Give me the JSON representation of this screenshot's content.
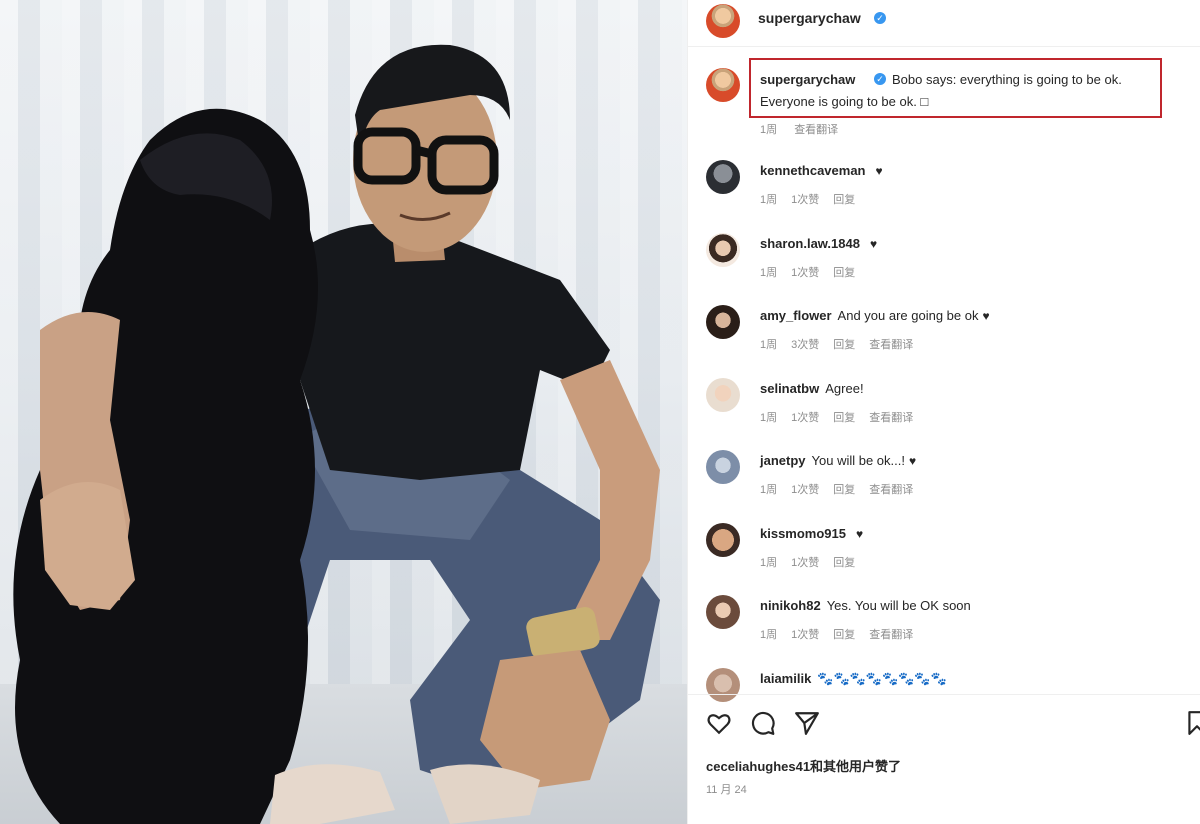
{
  "post": {
    "username": "supergarychaw",
    "caption": {
      "line1": "Bobo says: everything is going to be ok.",
      "line2": "Everyone is going to be ok. □"
    },
    "caption_meta": {
      "time": "1周",
      "translate": "查看翻译"
    },
    "likes_text": "ceceliahughes41和其他用户赞了",
    "date": "11 月 24"
  },
  "comments": [
    {
      "username": "kennethcaveman",
      "text": "",
      "heart": "♥",
      "time": "1周",
      "likes": "1次赞",
      "reply": "回复",
      "translate": ""
    },
    {
      "username": "sharon.law.1848",
      "text": "",
      "heart": "♥",
      "time": "1周",
      "likes": "1次赞",
      "reply": "回复",
      "translate": ""
    },
    {
      "username": "amy_flower",
      "text": "And you are going be ok",
      "heart": "♥",
      "time": "1周",
      "likes": "3次赞",
      "reply": "回复",
      "translate": "查看翻译"
    },
    {
      "username": "selinatbw",
      "text": "Agree!",
      "heart": "",
      "time": "1周",
      "likes": "1次赞",
      "reply": "回复",
      "translate": "查看翻译"
    },
    {
      "username": "janetpy",
      "text": "You will be ok...!",
      "heart": "♥",
      "time": "1周",
      "likes": "1次赞",
      "reply": "回复",
      "translate": "查看翻译"
    },
    {
      "username": "kissmomo915",
      "text": "",
      "heart": "♥",
      "time": "1周",
      "likes": "1次赞",
      "reply": "回复",
      "translate": ""
    },
    {
      "username": "ninikoh82",
      "text": "Yes. You will be OK soon",
      "heart": "",
      "time": "1周",
      "likes": "1次赞",
      "reply": "回复",
      "translate": "查看翻译"
    },
    {
      "username": "laiamilik",
      "text": "🐾🐾🐾🐾🐾🐾🐾🐾",
      "heart": "",
      "time": "",
      "likes": "",
      "reply": "",
      "translate": ""
    }
  ],
  "icons": {
    "like": "heart-outline-icon",
    "comment": "comment-bubble-icon",
    "share": "paper-plane-icon",
    "save": "bookmark-icon",
    "verified": "verified-badge-icon"
  },
  "colors": {
    "highlight_box": "#c0262d",
    "verified": "#3897f0",
    "meta_text": "#8e8e8e"
  }
}
